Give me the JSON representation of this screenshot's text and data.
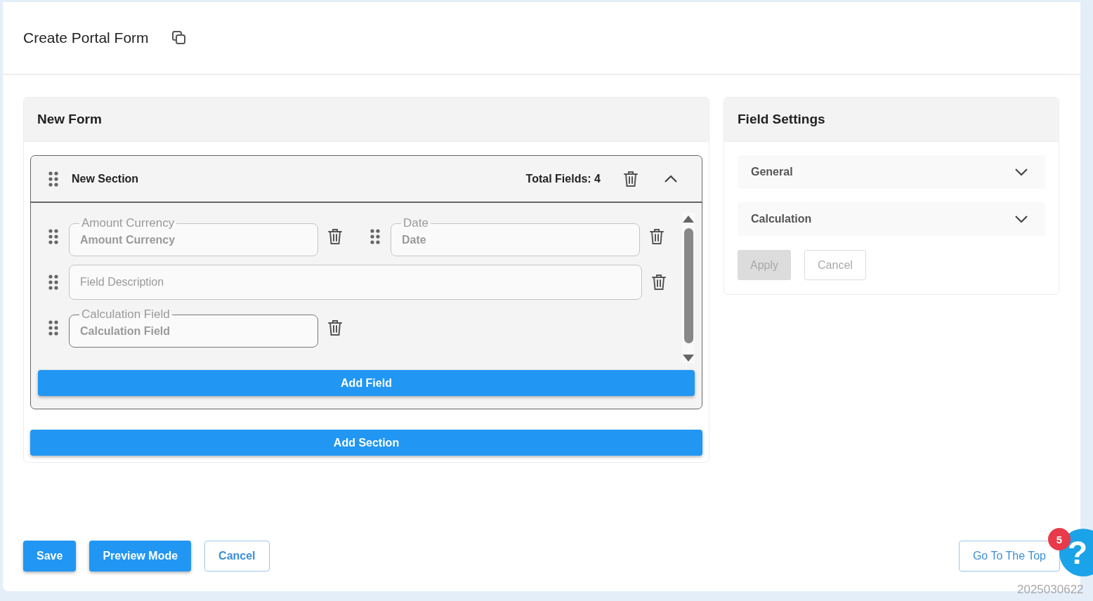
{
  "page": {
    "title": "Create Portal Form"
  },
  "form": {
    "title": "New Form",
    "sections": [
      {
        "title": "New Section",
        "field_count": "Total Fields: 4",
        "expanded": true,
        "rows": [
          {
            "items": [
              {
                "kind": "labeled",
                "label": "Amount Currency",
                "value": "Amount Currency",
                "focused": false
              },
              {
                "kind": "labeled",
                "label": "Date",
                "value": "Date",
                "focused": false
              }
            ]
          },
          {
            "items": [
              {
                "kind": "description",
                "placeholder": "Field Description"
              }
            ]
          },
          {
            "items": [
              {
                "kind": "labeled",
                "label": "Calculation Field",
                "value": "Calculation Field",
                "focused": true
              }
            ]
          }
        ],
        "add_field": "Add Field"
      }
    ],
    "add_section": "Add Section"
  },
  "settings": {
    "title": "Field Settings",
    "groups": [
      {
        "label": "General",
        "expanded": false
      },
      {
        "label": "Calculation",
        "expanded": false
      }
    ],
    "apply": {
      "label": "Apply",
      "disabled": true
    },
    "cancel": {
      "label": "Cancel"
    }
  },
  "footer": {
    "buttons": [
      {
        "label": "Save",
        "kind": "primary"
      },
      {
        "label": "Preview Mode",
        "kind": "primary"
      },
      {
        "label": "Cancel",
        "kind": "outline"
      }
    ],
    "top_button": "Go To The Top"
  },
  "help": {
    "label": "?",
    "badge": "5"
  },
  "version": "2025030622"
}
